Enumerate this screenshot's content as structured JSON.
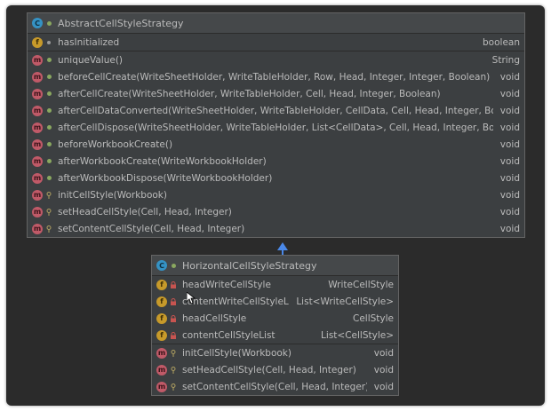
{
  "parent": {
    "name": "AbstractCellStyleStrategy",
    "fields": [
      {
        "name": "hasInitialized",
        "type": "boolean",
        "icon": "f",
        "visibility": "package"
      }
    ],
    "methods": [
      {
        "name": "uniqueValue()",
        "type": "String",
        "icon": "m",
        "visibility": "public"
      },
      {
        "name": "beforeCellCreate(WriteSheetHolder, WriteTableHolder, Row, Head, Integer, Integer, Boolean)",
        "type": "void",
        "icon": "m",
        "visibility": "public"
      },
      {
        "name": "afterCellCreate(WriteSheetHolder, WriteTableHolder, Cell, Head, Integer, Boolean)",
        "type": "void",
        "icon": "m",
        "visibility": "public"
      },
      {
        "name": "afterCellDataConverted(WriteSheetHolder, WriteTableHolder, CellData, Cell, Head, Integer, Boolean)",
        "type": "void",
        "icon": "m",
        "visibility": "public"
      },
      {
        "name": "afterCellDispose(WriteSheetHolder, WriteTableHolder, List<CellData>, Cell, Head, Integer, Boolean)",
        "type": "void",
        "icon": "m",
        "visibility": "public"
      },
      {
        "name": "beforeWorkbookCreate()",
        "type": "void",
        "icon": "m",
        "visibility": "public"
      },
      {
        "name": "afterWorkbookCreate(WriteWorkbookHolder)",
        "type": "void",
        "icon": "m",
        "visibility": "public"
      },
      {
        "name": "afterWorkbookDispose(WriteWorkbookHolder)",
        "type": "void",
        "icon": "m",
        "visibility": "public"
      },
      {
        "name": "initCellStyle(Workbook)",
        "type": "void",
        "icon": "m",
        "visibility": "protected"
      },
      {
        "name": "setHeadCellStyle(Cell, Head, Integer)",
        "type": "void",
        "icon": "m",
        "visibility": "protected"
      },
      {
        "name": "setContentCellStyle(Cell, Head, Integer)",
        "type": "void",
        "icon": "m",
        "visibility": "protected"
      }
    ]
  },
  "child": {
    "name": "HorizontalCellStyleStrategy",
    "fields": [
      {
        "name": "headWriteCellStyle",
        "type": "WriteCellStyle",
        "icon": "f",
        "visibility": "private"
      },
      {
        "name": "contentWriteCellStyleList",
        "type": "List<WriteCellStyle>",
        "icon": "f",
        "visibility": "private"
      },
      {
        "name": "headCellStyle",
        "type": "CellStyle",
        "icon": "f",
        "visibility": "private"
      },
      {
        "name": "contentCellStyleList",
        "type": "List<CellStyle>",
        "icon": "f",
        "visibility": "private"
      }
    ],
    "methods": [
      {
        "name": "initCellStyle(Workbook)",
        "type": "void",
        "icon": "m",
        "visibility": "protected"
      },
      {
        "name": "setHeadCellStyle(Cell, Head, Integer)",
        "type": "void",
        "icon": "m",
        "visibility": "protected"
      },
      {
        "name": "setContentCellStyle(Cell, Head, Integer)",
        "type": "void",
        "icon": "m",
        "visibility": "protected"
      }
    ]
  },
  "colors": {
    "background": "#2b2b2b",
    "box": "#3c3f41",
    "text": "#bbbbbb",
    "arrow": "#4a88e8",
    "class_icon": "#3592c4",
    "field_icon": "#c79a2a",
    "method_icon": "#c05a68"
  }
}
